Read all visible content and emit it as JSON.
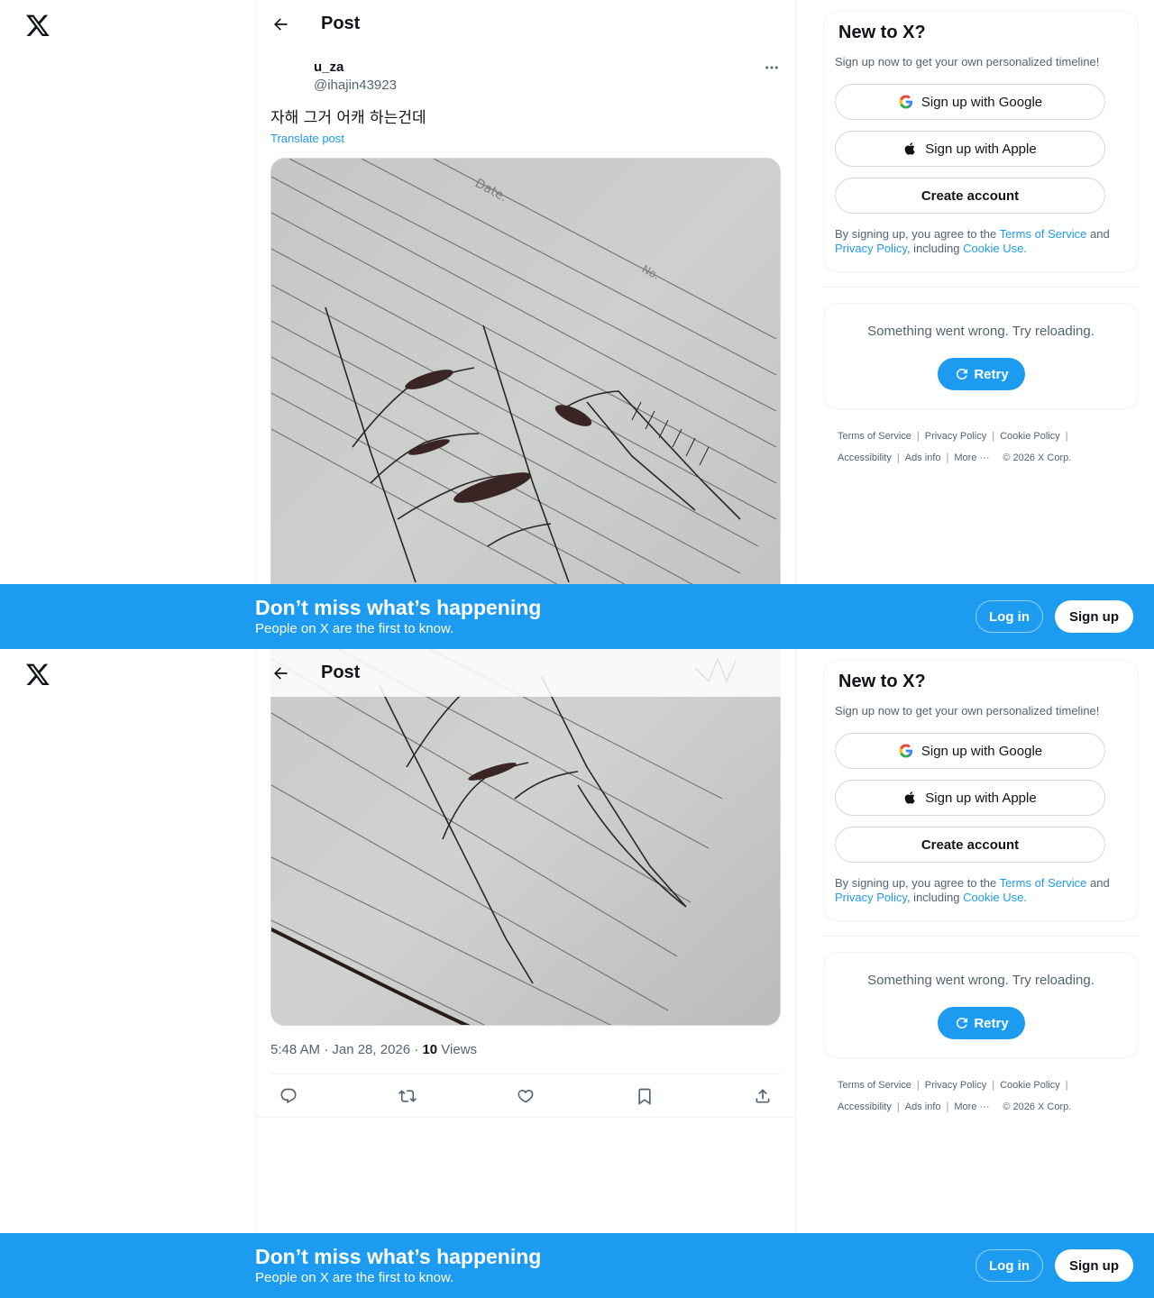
{
  "header": {
    "title": "Post"
  },
  "post": {
    "author_name": "u_za",
    "author_handle": "@ihajin43923",
    "text": "자해 그거 어캐 하는건데",
    "translate_label": "Translate post",
    "timestamp": "5:48 AM · Jan 28, 2026 · ",
    "views_count": "10",
    "views_label": " Views"
  },
  "signup": {
    "title": "New to X?",
    "subtitle": "Sign up now to get your own personalized timeline!",
    "google_label": "Sign up with Google",
    "apple_label": "Sign up with Apple",
    "create_label": "Create account",
    "legal_prefix": "By signing up, you agree to the ",
    "terms_link": "Terms of Service",
    "legal_and": " and",
    "privacy_link": "Privacy Policy",
    "legal_including": ", including ",
    "cookie_link": "Cookie Use."
  },
  "error": {
    "message": "Something went wrong. Try reloading.",
    "retry_label": "Retry"
  },
  "footer": {
    "terms": "Terms of Service",
    "privacy": "Privacy Policy",
    "cookie": "Cookie Policy",
    "accessibility": "Accessibility",
    "ads": "Ads info",
    "more": "More ···",
    "copyright": "© 2026 X Corp."
  },
  "banner": {
    "title": "Don’t miss what’s happening",
    "subtitle": "People on X are the first to know.",
    "login_label": "Log in",
    "signup_label": "Sign up"
  },
  "colors": {
    "accent": "#1d9bf0",
    "text": "#0f1419",
    "secondary": "#536471"
  },
  "icons": [
    "x-logo-icon",
    "back-arrow-icon",
    "more-icon",
    "reply-icon",
    "repost-icon",
    "like-icon",
    "bookmark-icon",
    "share-icon",
    "google-icon",
    "apple-icon",
    "refresh-icon"
  ]
}
